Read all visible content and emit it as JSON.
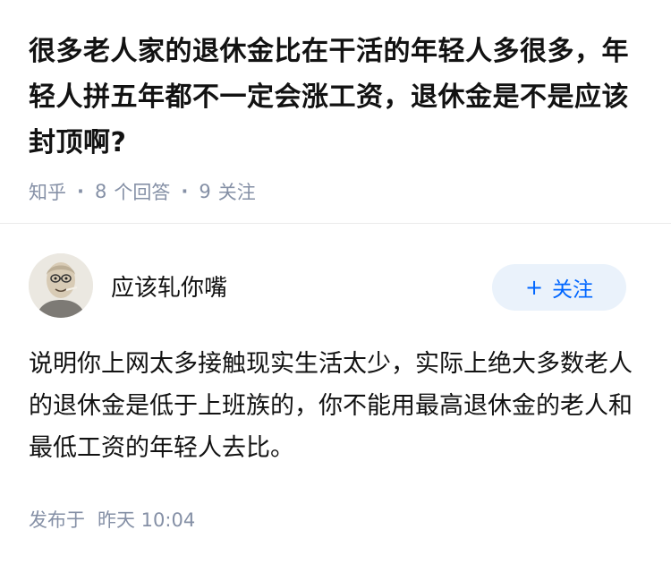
{
  "question": {
    "title": "很多老人家的退休金比在干活的年轻人多很多，年轻人拼五年都不一定会涨工资，退休金是不是应该封顶啊?",
    "source": "知乎",
    "answers_count": "8",
    "answers_label": "个回答",
    "followers_count": "9",
    "followers_label": "关注"
  },
  "answer": {
    "author_name": "应该轧你嘴",
    "avatar_icon": "avatar-cartoon-old-man",
    "follow_plus": "+",
    "follow_label": "关注",
    "content": "说明你上网太多接触现实生活太少，实际上绝大多数老人的退休金是低于上班族的，你不能用最高退休金的老人和最低工资的年轻人去比。",
    "published_label": "发布于",
    "published_time": "昨天 10:04"
  },
  "colors": {
    "text": "#121212",
    "meta": "#8590a6",
    "accent": "#0066ff",
    "follow_bg": "#eaf2fb"
  }
}
